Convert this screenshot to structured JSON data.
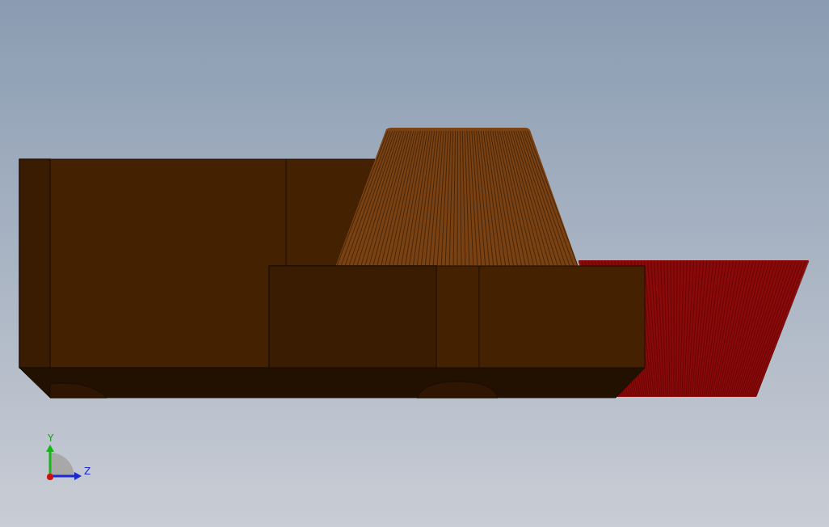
{
  "viewport": {
    "triad": {
      "axes": [
        {
          "kind": "y",
          "label": "Y"
        },
        {
          "kind": "z",
          "label": "Z"
        }
      ]
    }
  }
}
